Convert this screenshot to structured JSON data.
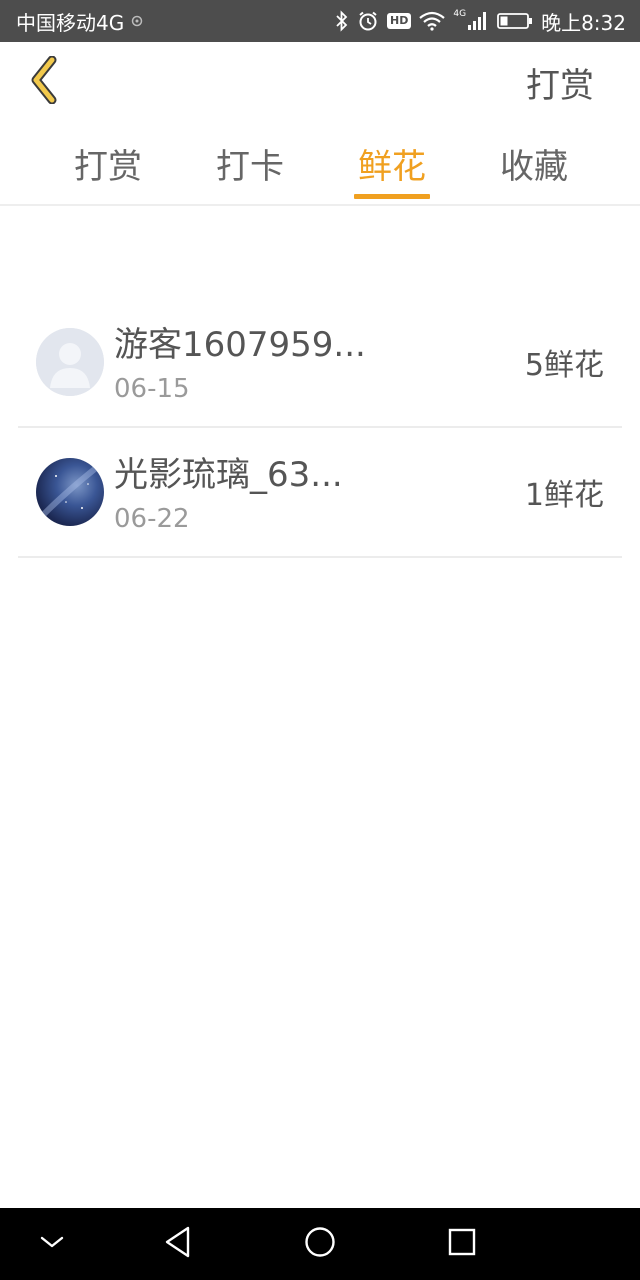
{
  "status_bar": {
    "carrier": "中国移动4G",
    "time": "晚上8:32",
    "hd_label": "HD",
    "network_label": "4G",
    "icons": [
      "notification-icon",
      "bluetooth-icon",
      "alarm-icon",
      "hd-icon",
      "wifi-icon",
      "signal-icon",
      "battery-icon"
    ]
  },
  "header": {
    "back_icon": "back-chevron-icon",
    "action_label": "打赏"
  },
  "tabs": [
    {
      "label": "打赏",
      "active": false
    },
    {
      "label": "打卡",
      "active": false
    },
    {
      "label": "鲜花",
      "active": true
    },
    {
      "label": "收藏",
      "active": false
    }
  ],
  "list": [
    {
      "name": "游客1607959...",
      "date": "06-15",
      "count": "5鲜花",
      "avatar": "default-avatar"
    },
    {
      "name": "光影琉璃_63...",
      "date": "06-22",
      "count": "1鲜花",
      "avatar": "night-sky-avatar"
    }
  ],
  "nav_bar": {
    "icons": [
      "collapse-chevron-icon",
      "back-triangle-icon",
      "home-circle-icon",
      "recents-square-icon"
    ]
  },
  "colors": {
    "accent": "#f0a020",
    "status_bar": "#4d4d4d",
    "nav_bar": "#000000",
    "back_chevron": "#f2c94c"
  }
}
